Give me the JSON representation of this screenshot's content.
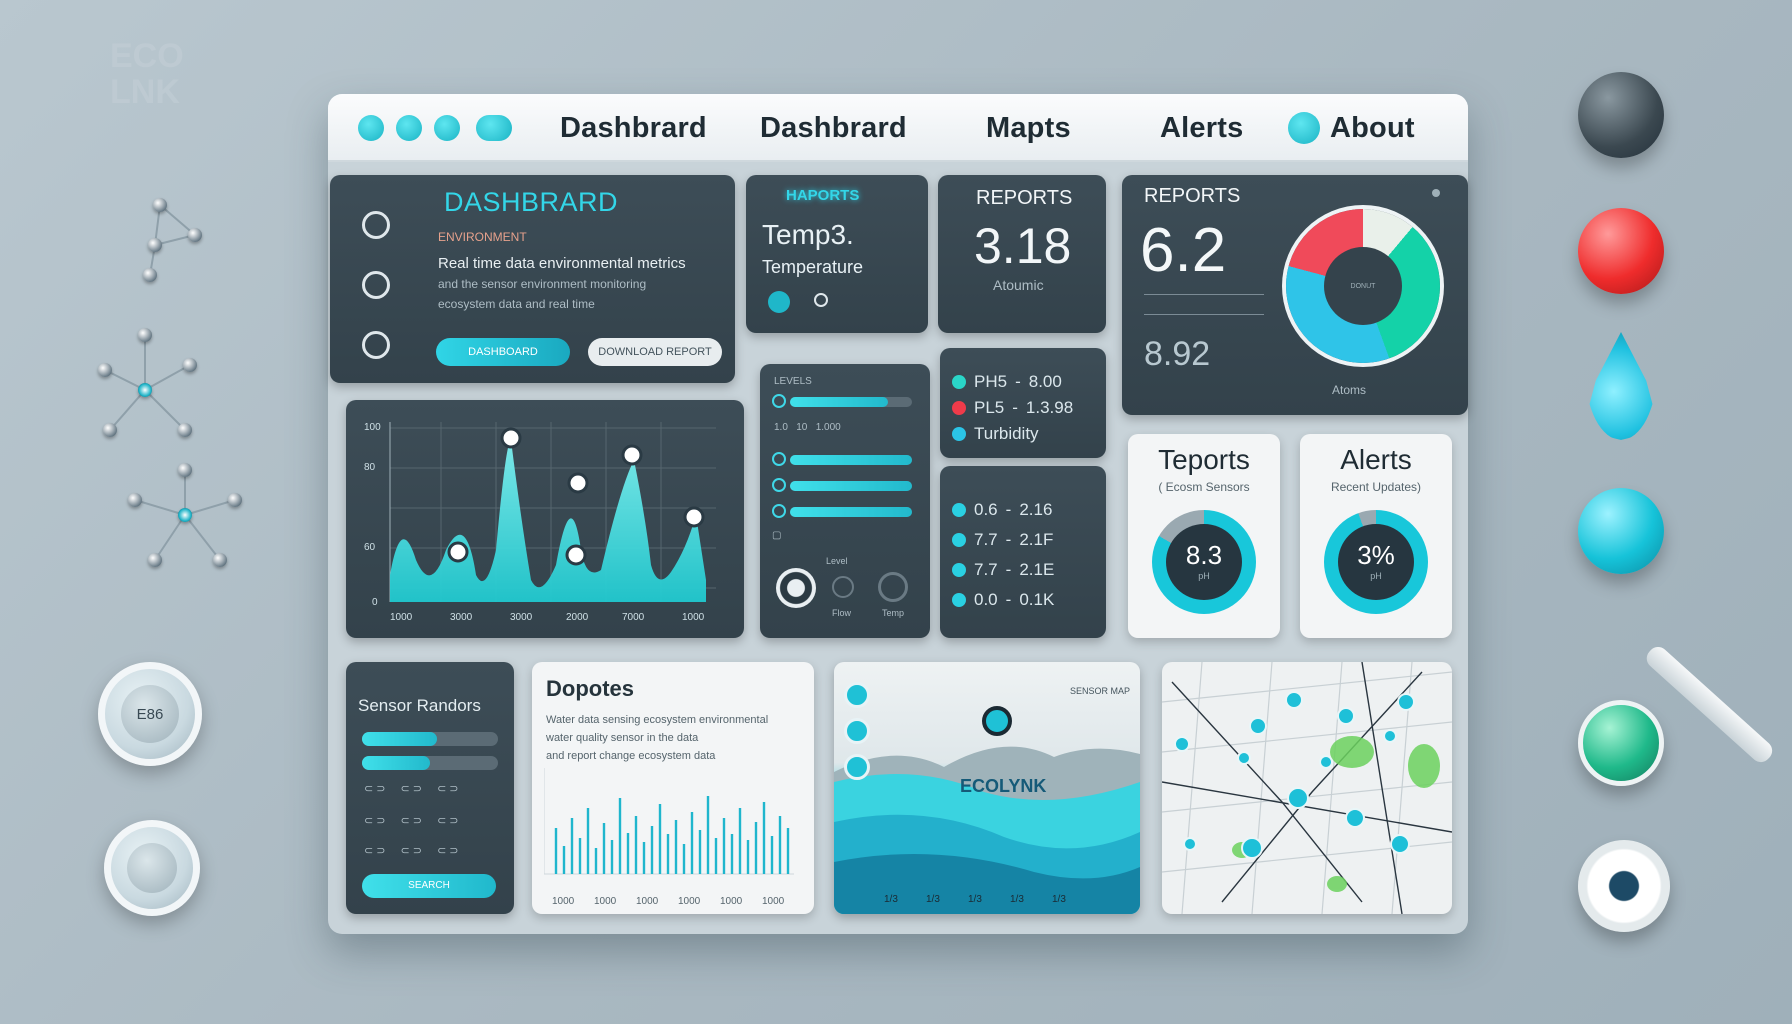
{
  "brand": {
    "watermark_line1": "ECO",
    "watermark_line2": "LNK"
  },
  "nav": {
    "items": [
      "Dashbrard",
      "Dashbrard",
      "Mapts",
      "Alerts",
      "About"
    ]
  },
  "overview": {
    "title": "DASHBRARD",
    "subtitle": "ENVIRONMENT",
    "line1": "Real time data environmental metrics",
    "line2": "and the sensor environment monitoring",
    "line3": "ecosystem data and real time",
    "primary_button": "DASHBOARD",
    "secondary_button": "DOWNLOAD REPORT"
  },
  "temp_card": {
    "badge": "HAPORTS",
    "big": "Temp3.",
    "label": "Temperature"
  },
  "reports_card_small": {
    "title": "REPORTS",
    "value": "3.18",
    "sub": "Atoumic"
  },
  "reports_card_large": {
    "title": "REPORTS",
    "value": "6.2",
    "value2": "8.92",
    "sub": "Atoms",
    "donut_center": "DONUT"
  },
  "main_chart": {
    "y_ticks": [
      "100",
      "80",
      "60",
      "0"
    ],
    "x_ticks": [
      "1000",
      "3000",
      "3000",
      "2000",
      "7000",
      "1000"
    ]
  },
  "sensor_levels": {
    "header": "LEVELS",
    "rows": [
      {
        "label": "",
        "level": 0.8
      },
      {
        "label": "",
        "level": 0.0
      },
      {
        "label": "",
        "level": 1.0
      },
      {
        "label": "",
        "level": 1.0
      },
      {
        "label": "",
        "level": 1.0
      }
    ],
    "small_label1": "Level",
    "small_label2": "Flow",
    "small_label3": "Temp"
  },
  "legend_top": {
    "rows": [
      {
        "name": "PH5",
        "value": "8.00",
        "color": "#2ad6c8"
      },
      {
        "name": "PL5",
        "value": "1.3.98",
        "color": "#ef3b4a"
      },
      {
        "name": "Turbidity",
        "value": "",
        "color": "#2bc4e6"
      }
    ]
  },
  "legend_bottom": {
    "rows": [
      {
        "name": "0.6",
        "value": "2.16"
      },
      {
        "name": "7.7",
        "value": "2.1F"
      },
      {
        "name": "7.7",
        "value": "2.1E"
      },
      {
        "name": "0.0",
        "value": "0.1K"
      }
    ]
  },
  "teports": {
    "title": "Teports",
    "subtitle": "( Ecosm Sensors",
    "value": "8.3",
    "unit": "pH"
  },
  "alerts_card": {
    "title": "Alerts",
    "subtitle": "Recent Updates)",
    "value": "3%",
    "unit": "pH"
  },
  "sensor_readings": {
    "title": "Sensor Randors",
    "button": "SEARCH",
    "levels": [
      0.55,
      0.5
    ]
  },
  "doc_panel": {
    "title": "Dopotes",
    "lines": [
      "Water data sensing ecosystem environmental",
      "water quality sensor in the data",
      "and report change ecosystem data"
    ],
    "x_ticks": [
      "1000",
      "1000",
      "1000",
      "1000",
      "1000",
      "1000"
    ]
  },
  "map_card": {
    "brand": "ECOLYNK",
    "label": "SENSOR MAP",
    "x_ticks": [
      "1/3",
      "1/3",
      "1/3",
      "1/3",
      "1/3"
    ]
  },
  "colors": {
    "accent": "#2ad0e2",
    "panel": "#3a4a54",
    "alert_red": "#ef3b4a"
  }
}
